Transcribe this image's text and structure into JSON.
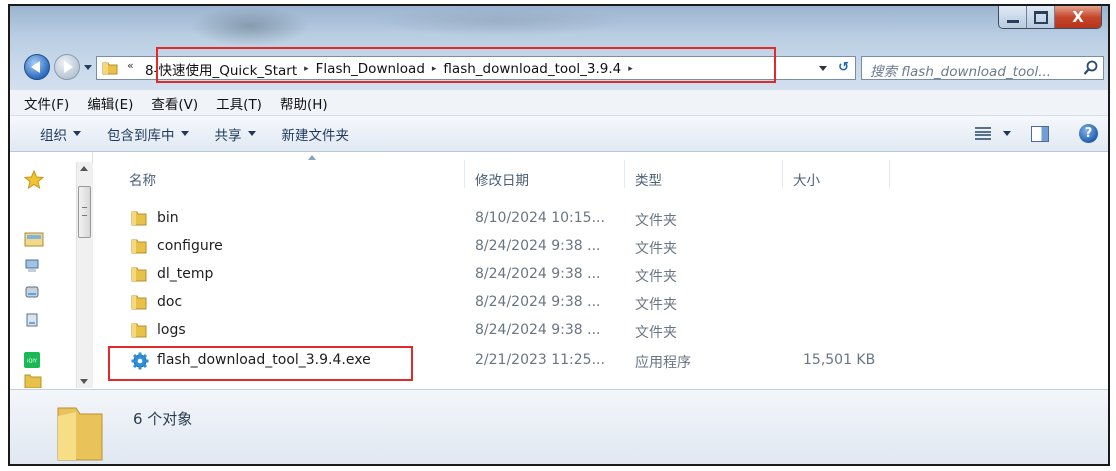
{
  "window": {
    "close_glyph": "X"
  },
  "address": {
    "breadcrumb": [
      "8-快速使用_Quick_Start",
      "Flash_Download",
      "flash_download_tool_3.9.4"
    ],
    "separator": "▸"
  },
  "search": {
    "placeholder": "搜索 flash_download_tool..."
  },
  "menubar": [
    "文件(F)",
    "编辑(E)",
    "查看(V)",
    "工具(T)",
    "帮助(H)"
  ],
  "toolbar": {
    "organize": "组织",
    "include_in_library": "包含到库中",
    "share": "共享",
    "new_folder": "新建文件夹"
  },
  "columns": {
    "name": "名称",
    "date": "修改日期",
    "type": "类型",
    "size": "大小"
  },
  "files": [
    {
      "name": "bin",
      "date": "8/10/2024 10:15...",
      "type": "文件夹",
      "size": "",
      "icon": "folder-icon"
    },
    {
      "name": "configure",
      "date": "8/24/2024 9:38 ...",
      "type": "文件夹",
      "size": "",
      "icon": "folder-icon"
    },
    {
      "name": "dl_temp",
      "date": "8/24/2024 9:38 ...",
      "type": "文件夹",
      "size": "",
      "icon": "folder-icon"
    },
    {
      "name": "doc",
      "date": "8/24/2024 9:38 ...",
      "type": "文件夹",
      "size": "",
      "icon": "folder-icon"
    },
    {
      "name": "logs",
      "date": "8/24/2024 9:38 ...",
      "type": "文件夹",
      "size": "",
      "icon": "folder-icon"
    },
    {
      "name": "flash_download_tool_3.9.4.exe",
      "date": "2/21/2023 11:25...",
      "type": "应用程序",
      "size": "15,501 KB",
      "icon": "gear-app-icon"
    }
  ],
  "details": {
    "count_text": "6 个对象"
  },
  "colors": {
    "highlight_box": "#e12b2b",
    "folder": "#e8c14a",
    "app_icon": "#2f8fd8"
  }
}
